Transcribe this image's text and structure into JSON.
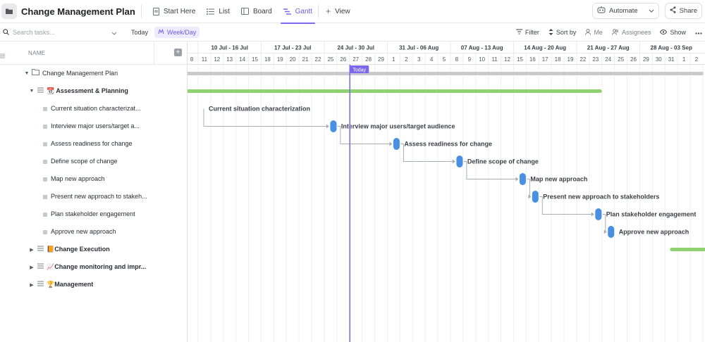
{
  "header": {
    "title": "Change Management Plan",
    "tabs": [
      {
        "label": "Start Here",
        "icon": "doc-icon"
      },
      {
        "label": "List",
        "icon": "list-icon"
      },
      {
        "label": "Board",
        "icon": "board-icon"
      },
      {
        "label": "Gantt",
        "icon": "gantt-icon",
        "active": true
      }
    ],
    "add_view": "View",
    "automate": "Automate",
    "share": "Share"
  },
  "toolbar": {
    "search_placeholder": "Search tasks...",
    "today": "Today",
    "week_day": "Week/Day",
    "filter": "Filter",
    "sort_by": "Sort by",
    "me": "Me",
    "assignees": "Assignees",
    "show": "Show"
  },
  "left_panel": {
    "column_name": "NAME",
    "rows": [
      {
        "label": "Change Management Plan",
        "level": 0,
        "type": "folder",
        "expanded": true,
        "bold": false
      },
      {
        "label": "📆 Assessment & Planning",
        "level": 1,
        "type": "list",
        "expanded": true,
        "bold": true
      },
      {
        "label": "Current situation characterizat...",
        "level": 2,
        "type": "task"
      },
      {
        "label": "Interview major users/target a...",
        "level": 2,
        "type": "task"
      },
      {
        "label": "Assess readiness for change",
        "level": 2,
        "type": "task"
      },
      {
        "label": "Define scope of change",
        "level": 2,
        "type": "task"
      },
      {
        "label": "Map new approach",
        "level": 2,
        "type": "task"
      },
      {
        "label": "Present new approach to stakeh...",
        "level": 2,
        "type": "task"
      },
      {
        "label": "Plan stakeholder engagement",
        "level": 2,
        "type": "task"
      },
      {
        "label": "Approve new approach",
        "level": 2,
        "type": "task"
      },
      {
        "label": "📙Change Execution",
        "level": 1,
        "type": "list",
        "expanded": false,
        "bold": true
      },
      {
        "label": "📈Change monitoring and impr...",
        "level": 1,
        "type": "list",
        "expanded": false,
        "bold": true
      },
      {
        "label": "🏆Management",
        "level": 1,
        "type": "list",
        "expanded": false,
        "bold": true
      }
    ]
  },
  "gantt": {
    "weeks": [
      "10 Jul - 16 Jul",
      "17 Jul - 23 Jul",
      "24 Jul - 30 Jul",
      "31 Jul - 06 Aug",
      "07 Aug - 13 Aug",
      "14 Aug - 20 Aug",
      "21 Aug - 27 Aug",
      "28 Aug - 03 Sep"
    ],
    "days": [
      "8",
      "11",
      "12",
      "13",
      "14",
      "15",
      "18",
      "19",
      "20",
      "21",
      "22",
      "25",
      "26",
      "27",
      "28",
      "29",
      "1",
      "2",
      "3",
      "4",
      "5",
      "8",
      "9",
      "10",
      "11",
      "12",
      "15",
      "16",
      "17",
      "18",
      "19",
      "22",
      "23",
      "24",
      "25",
      "26",
      "29",
      "30",
      "31",
      "1",
      "2"
    ],
    "today_label": "Today",
    "today_day_index": 13,
    "project_bar": {
      "start_day_index": 0,
      "end_day_index": 41
    },
    "phase_bar": {
      "start_day_index": 0,
      "end_day_index": 33
    },
    "next_phase_bar": {
      "start_day_index": 38,
      "end_day_index": 41
    },
    "tasks": [
      {
        "label": "Current situation characterization",
        "day_index": 0
      },
      {
        "label": "Interview major users/target audience",
        "day_index": 11
      },
      {
        "label": "Assess readiness for change",
        "day_index": 16
      },
      {
        "label": "Define scope of change",
        "day_index": 21
      },
      {
        "label": "Map new approach",
        "day_index": 26
      },
      {
        "label": "Present new approach to stakeholders",
        "day_index": 27
      },
      {
        "label": "Plan stakeholder engagement",
        "day_index": 32
      },
      {
        "label": "Approve new approach",
        "day_index": 33
      }
    ],
    "colors": {
      "today_line": "#7b68ee",
      "task_milestone": "#4a90e2",
      "project_bar": "#c9cacd",
      "phase_bar": "#8fd26f",
      "dependency": "#a9adb4"
    }
  }
}
